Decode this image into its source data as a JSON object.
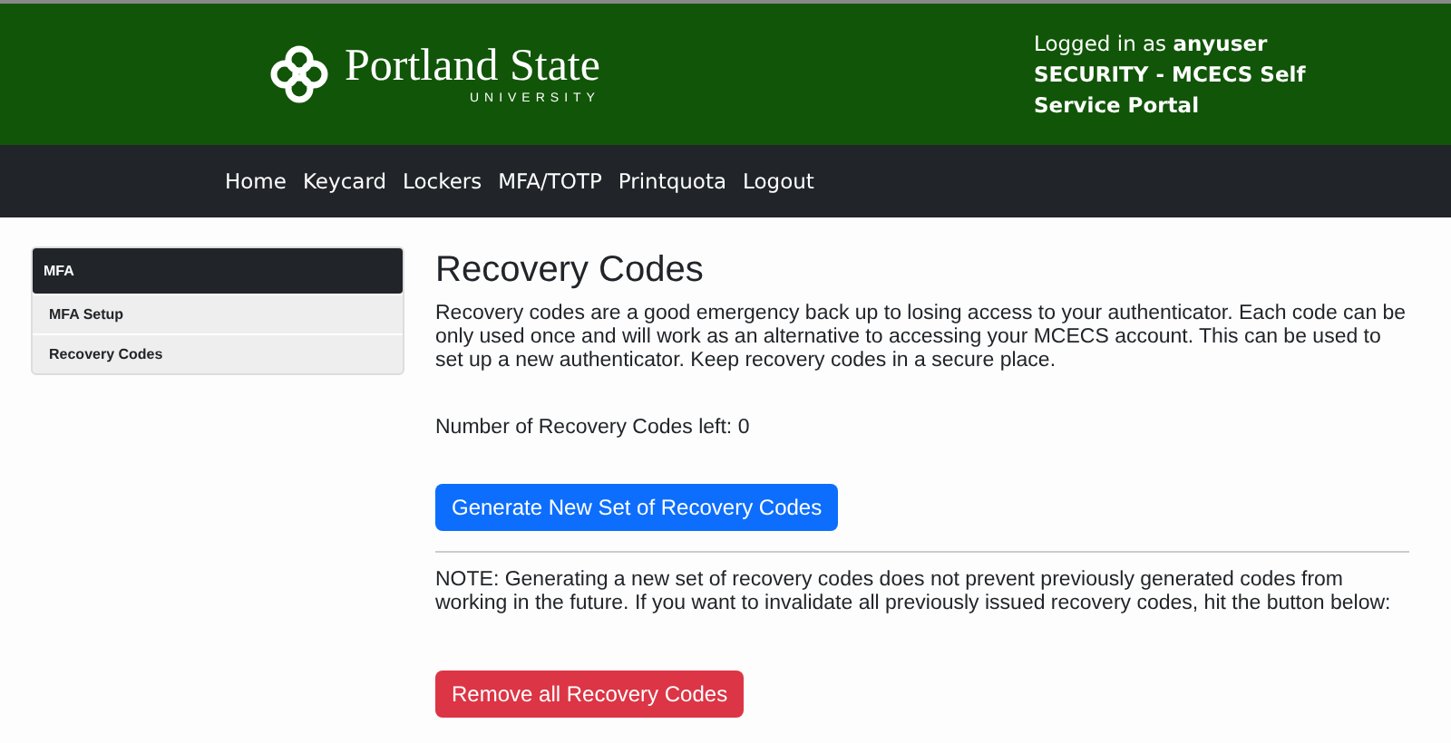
{
  "header": {
    "logo": {
      "name": "Portland State",
      "subtitle": "UNIVERSITY"
    },
    "login_prefix": "Logged in as ",
    "username": "anyuser",
    "portal": "SECURITY - MCECS Self Service Portal"
  },
  "nav": [
    "Home",
    "Keycard",
    "Lockers",
    "MFA/TOTP",
    "Printquota",
    "Logout"
  ],
  "sidebar": {
    "heading": "MFA",
    "items": [
      "MFA Setup",
      "Recovery Codes"
    ]
  },
  "content": {
    "title": "Recovery Codes",
    "intro": "Recovery codes are a good emergency back up to losing access to your authenticator. Each code can be only used once and will work as an alternative to accessing your MCECS account. This can be used to set up a new authenticator. Keep recovery codes in a secure place.",
    "count": "Number of Recovery Codes left: 0",
    "generate_button": {
      "label": "Generate New Set of Recovery Codes",
      "kind": "primary"
    },
    "note": "NOTE: Generating a new set of recovery codes does not prevent previously generated codes from working in the future. If you want to invalidate all previously issued recovery codes, hit the button below:",
    "remove_button": {
      "label": "Remove all Recovery Codes",
      "kind": "danger"
    }
  }
}
